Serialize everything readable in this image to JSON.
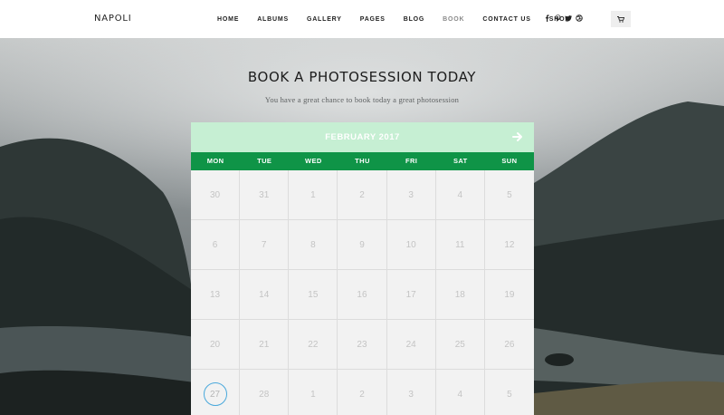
{
  "header": {
    "logo": "NAPOLI",
    "nav": [
      {
        "label": "HOME",
        "active": false
      },
      {
        "label": "ALBUMS",
        "active": false
      },
      {
        "label": "GALLERY",
        "active": false
      },
      {
        "label": "PAGES",
        "active": false
      },
      {
        "label": "BLOG",
        "active": false
      },
      {
        "label": "BOOK",
        "active": true
      },
      {
        "label": "CONTACT US",
        "active": false
      },
      {
        "label": "SHOP",
        "active": false
      }
    ],
    "social_icons": [
      "facebook-icon",
      "pinterest-icon",
      "twitter-icon",
      "dribbble-icon"
    ],
    "cart_icon": "cart-icon"
  },
  "hero": {
    "title": "BOOK A PHOTOSESSION TODAY",
    "subtitle": "You have a great chance to book today a great photosession"
  },
  "calendar": {
    "month": "FEBRUARY 2017",
    "next_icon": "arrow-right-icon",
    "weekdays": [
      "MON",
      "TUE",
      "WED",
      "THU",
      "FRI",
      "SAT",
      "SUN"
    ],
    "weeks": [
      [
        "30",
        "31",
        "1",
        "2",
        "3",
        "4",
        "5"
      ],
      [
        "6",
        "7",
        "8",
        "9",
        "10",
        "11",
        "12"
      ],
      [
        "13",
        "14",
        "15",
        "16",
        "17",
        "18",
        "19"
      ],
      [
        "20",
        "21",
        "22",
        "23",
        "24",
        "25",
        "26"
      ],
      [
        "27",
        "28",
        "1",
        "2",
        "3",
        "4",
        "5"
      ]
    ],
    "highlighted_day": "27",
    "colors": {
      "header_bg": "#c6efd3",
      "weekday_bg": "#0f9447",
      "highlight_ring": "#4aa9dc"
    }
  }
}
